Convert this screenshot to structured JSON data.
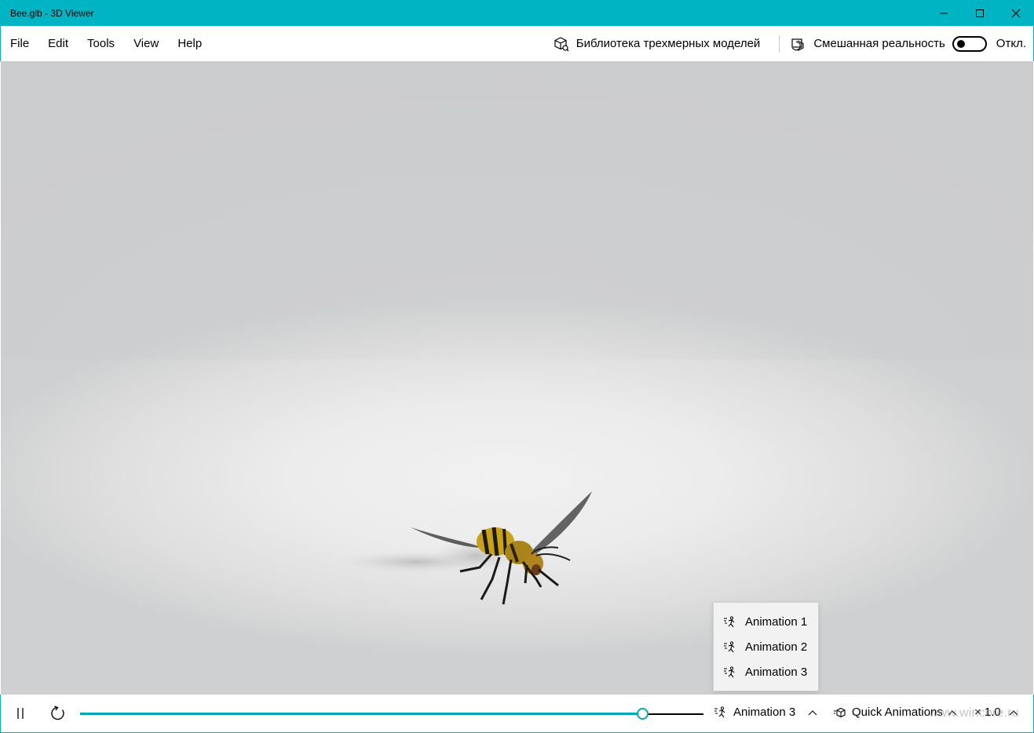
{
  "window": {
    "title": "Bee.glb - 3D Viewer",
    "accent_color": "#00b4c3"
  },
  "menu": {
    "items": [
      "File",
      "Edit",
      "Tools",
      "View",
      "Help"
    ],
    "library_label": "Библиотека трехмерных моделей",
    "mixed_reality_label": "Смешанная реальность",
    "toggle_state_label": "Откл."
  },
  "animation_menu": {
    "items": [
      "Animation 1",
      "Animation 2",
      "Animation 3"
    ]
  },
  "playback": {
    "progress": 0.902,
    "selected_animation": "Animation 3",
    "quick_animations_label": "Quick Animations",
    "speed_label": "× 1.0"
  },
  "watermark": "www.wincore.ru",
  "icons": {
    "window": [
      "minimize-icon",
      "maximize-icon",
      "close-icon"
    ],
    "menu": [
      "cube-library-icon",
      "mixed-reality-icon"
    ],
    "bottom": [
      "pause-icon",
      "restart-icon",
      "animation-icon",
      "chevron-up-icon",
      "quick-animations-icon"
    ]
  }
}
